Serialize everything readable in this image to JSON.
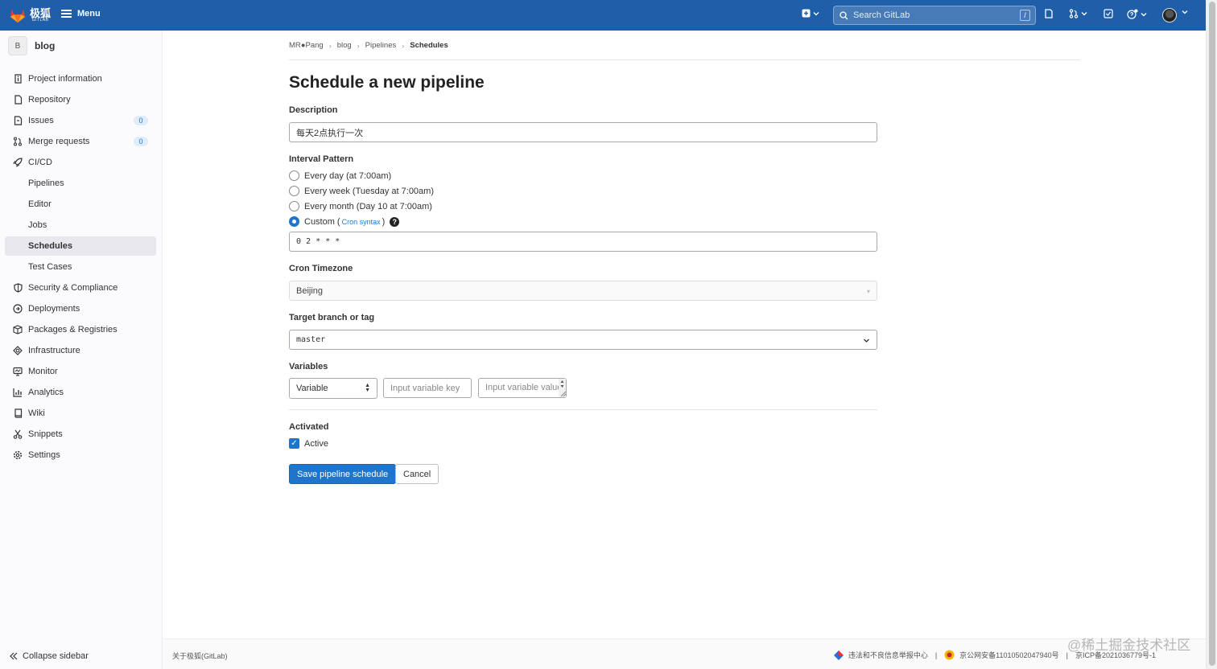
{
  "topbar": {
    "logo_text": "极狐",
    "logo_sub": "GITLAB",
    "menu_label": "Menu",
    "search_placeholder": "Search GitLab",
    "search_shortcut": "/"
  },
  "sidebar": {
    "project_initial": "B",
    "project_name": "blog",
    "items": [
      {
        "label": "Project information",
        "icon": "info-icon"
      },
      {
        "label": "Repository",
        "icon": "doc-icon"
      },
      {
        "label": "Issues",
        "icon": "issues-icon",
        "badge": "0"
      },
      {
        "label": "Merge requests",
        "icon": "merge-request-icon",
        "badge": "0"
      },
      {
        "label": "CI/CD",
        "icon": "rocket-icon"
      },
      {
        "label": "Pipelines",
        "sub": true
      },
      {
        "label": "Editor",
        "sub": true
      },
      {
        "label": "Jobs",
        "sub": true
      },
      {
        "label": "Schedules",
        "sub": true,
        "active": true
      },
      {
        "label": "Test Cases",
        "sub": true
      },
      {
        "label": "Security & Compliance",
        "icon": "shield-icon"
      },
      {
        "label": "Deployments",
        "icon": "deployments-icon"
      },
      {
        "label": "Packages & Registries",
        "icon": "package-icon"
      },
      {
        "label": "Infrastructure",
        "icon": "infrastructure-icon"
      },
      {
        "label": "Monitor",
        "icon": "monitor-icon"
      },
      {
        "label": "Analytics",
        "icon": "chart-icon"
      },
      {
        "label": "Wiki",
        "icon": "book-icon"
      },
      {
        "label": "Snippets",
        "icon": "scissors-icon"
      },
      {
        "label": "Settings",
        "icon": "gear-icon"
      }
    ],
    "collapse_label": "Collapse sidebar"
  },
  "breadcrumb": [
    "MR●Pang",
    "blog",
    "Pipelines",
    "Schedules"
  ],
  "page_title": "Schedule a new pipeline",
  "form": {
    "description_label": "Description",
    "description_value": "每天2点执行一次",
    "interval_label": "Interval Pattern",
    "interval_options": [
      {
        "label": "Every day (at 7:00am)",
        "checked": false
      },
      {
        "label": "Every week (Tuesday at 7:00am)",
        "checked": false
      },
      {
        "label": "Every month (Day 10 at 7:00am)",
        "checked": false
      },
      {
        "label": "Custom",
        "checked": true
      }
    ],
    "custom_paren_open": "(",
    "cron_syntax_link": "Cron syntax",
    "custom_paren_close": ")",
    "cron_value": "0 2 * * *",
    "timezone_label": "Cron Timezone",
    "timezone_value": "Beijing",
    "branch_label": "Target branch or tag",
    "branch_value": "master",
    "variables_label": "Variables",
    "variable_type": "Variable",
    "variable_key_placeholder": "Input variable key",
    "variable_value_placeholder": "Input variable value",
    "activated_label": "Activated",
    "active_checkbox_label": "Active",
    "active_checked": true,
    "save_button": "Save pipeline schedule",
    "cancel_button": "Cancel"
  },
  "footer": {
    "about": "关于极狐(GitLab)",
    "report": "违法和不良信息举报中心",
    "police_record": "京公网安备11010502047940号",
    "icp_record": "京ICP备2021036779号-1"
  },
  "watermark": "@稀土掘金技术社区",
  "colors": {
    "topbar": "#1f5fa9",
    "accent": "#1f75cb",
    "sidebar_bg": "#fbfafd"
  }
}
